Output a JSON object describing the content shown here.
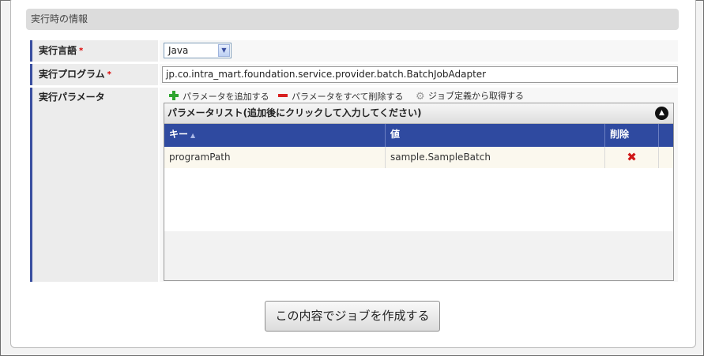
{
  "section": {
    "title": "実行時の情報"
  },
  "form": {
    "language": {
      "label": "実行言語",
      "required_mark": "*",
      "selected": "Java"
    },
    "program": {
      "label": "実行プログラム",
      "required_mark": "*",
      "value": "jp.co.intra_mart.foundation.service.provider.batch.BatchJobAdapter"
    },
    "parameters": {
      "label": "実行パラメータ",
      "actions": {
        "add": "パラメータを追加する",
        "delete_all": "パラメータをすべて削除する",
        "get_from_job": "ジョブ定義から取得する"
      },
      "grid": {
        "title": "パラメータリスト(追加後にクリックして入力してください)",
        "columns": {
          "key": "キー",
          "value": "値",
          "delete": "削除"
        },
        "rows": [
          {
            "key": "programPath",
            "value": "sample.SampleBatch"
          }
        ]
      }
    }
  },
  "buttons": {
    "submit": "この内容でジョブを作成する"
  },
  "icons": {
    "add": "plus-icon",
    "delete_all": "minus-icon",
    "get_from_job": "gear-icon",
    "collapse": "collapse-icon",
    "sort": "sort-icon",
    "row_delete": "delete-icon"
  },
  "colors": {
    "header_blue": "#2f4aa0",
    "required": "#d00000",
    "add_green": "#2fa52f",
    "delete_red": "#d82020"
  }
}
